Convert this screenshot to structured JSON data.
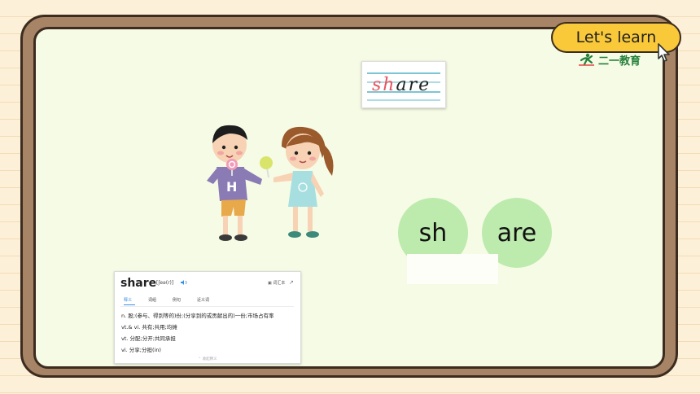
{
  "badge": {
    "label": "Let's learn"
  },
  "brand": {
    "name": "二一教育"
  },
  "word_card": {
    "onset": "sh",
    "rime": "are"
  },
  "syllables": [
    "sh",
    "are"
  ],
  "dictionary": {
    "headword": "share",
    "phonetic": "[ʃeə(r)]",
    "vocab_button": "词汇本",
    "tabs": [
      "释义",
      "词组",
      "例句",
      "近义词"
    ],
    "active_tab": 0,
    "definitions": [
      "n.  股;(参与、得到等的)份;(分享到的或贡献出的)一份;市场占有率",
      "vt.& vi.  共有;共用;均摊",
      "vt.  分配;分开;共同承担",
      "vi.  分享;分担(in)"
    ],
    "more_label": "收起释义"
  },
  "colors": {
    "accent_badge": "#f9c93a",
    "board": "#f6fbe5",
    "frame": "#a68465",
    "syllable_circle": "#bdeaad",
    "onset_red": "#e8555f",
    "card_line": "#7cc6d4",
    "link_blue": "#3a8ee6"
  }
}
